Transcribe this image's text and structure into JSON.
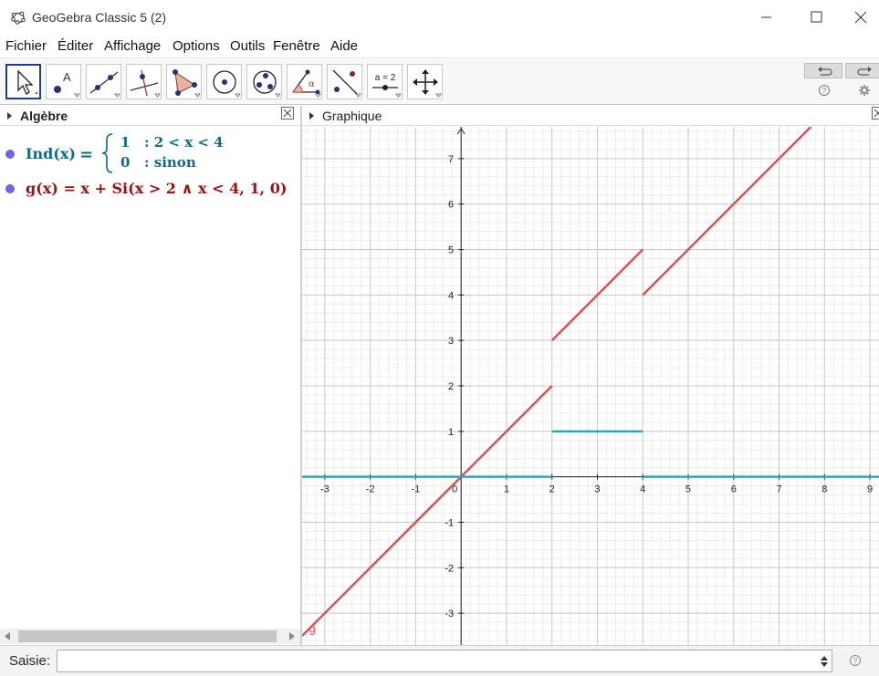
{
  "window": {
    "title": "GeoGebra Classic 5 (2)"
  },
  "menu": [
    "Fichier",
    "Éditer",
    "Affichage",
    "Options",
    "Outils",
    "Fenêtre",
    "Aide"
  ],
  "toolbar": {
    "tools": [
      {
        "icon": "move-arrow-icon"
      },
      {
        "icon": "point-icon"
      },
      {
        "icon": "line-icon"
      },
      {
        "icon": "perpendicular-line-icon"
      },
      {
        "icon": "polygon-icon"
      },
      {
        "icon": "circle-icon"
      },
      {
        "icon": "conic-icon"
      },
      {
        "icon": "angle-icon"
      },
      {
        "icon": "reflect-icon"
      },
      {
        "icon": "slider-icon",
        "label": "a = 2"
      },
      {
        "icon": "move-graphics-icon"
      }
    ]
  },
  "algebra": {
    "title": "Algèbre",
    "ind": {
      "lhs": "Ind(x)",
      "eq": "=",
      "case1_val": "1",
      "case1_cond": ": 2 < x < 4",
      "case2_val": "0",
      "case2_cond": ": sinon",
      "color": "#0e6a85"
    },
    "g": {
      "text": "g(x)  = x + Si(x > 2 ∧ x < 4, 1, 0)",
      "color": "#a01010"
    }
  },
  "graphics": {
    "title": "Graphique",
    "x_ticks": [
      "-3",
      "-2",
      "-1",
      "0",
      "1",
      "2",
      "3",
      "4",
      "5",
      "6",
      "7",
      "8",
      "9"
    ],
    "y_ticks": [
      "-3",
      "-2",
      "-1",
      "1",
      "2",
      "3",
      "4",
      "5",
      "6",
      "7"
    ],
    "curve_label": "g"
  },
  "chart_data": {
    "type": "line",
    "xlim": [
      -3.5,
      9.2
    ],
    "ylim": [
      -3.7,
      7.7
    ],
    "grid": true,
    "series": [
      {
        "name": "g",
        "color": "#e05050",
        "segments": [
          [
            [
              -3.5,
              -3.5
            ],
            [
              2,
              2
            ]
          ],
          [
            [
              2,
              3
            ],
            [
              4,
              5
            ]
          ],
          [
            [
              4,
              4
            ],
            [
              7.7,
              7.7
            ]
          ]
        ]
      },
      {
        "name": "Ind",
        "color": "#2aa7c0",
        "segments": [
          [
            [
              -3.5,
              0
            ],
            [
              2,
              0
            ]
          ],
          [
            [
              2,
              1
            ],
            [
              4,
              1
            ]
          ],
          [
            [
              4,
              0
            ],
            [
              9.2,
              0
            ]
          ]
        ]
      }
    ]
  },
  "input": {
    "label": "Saisie:",
    "value": ""
  }
}
